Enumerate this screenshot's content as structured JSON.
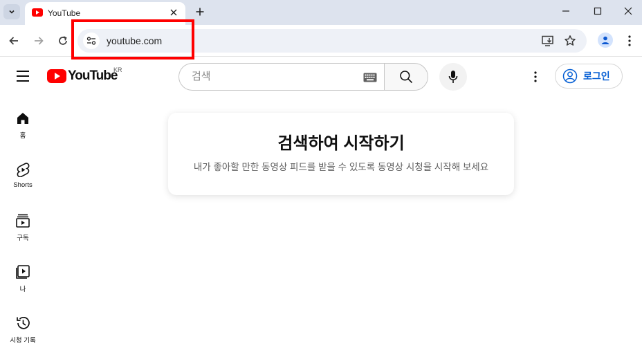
{
  "browser": {
    "tab": {
      "title": "YouTube"
    },
    "address": {
      "url": "youtube.com"
    },
    "colors": {
      "highlight": "#ff0000",
      "tabstrip": "#dde3ee",
      "omnibox": "#eef1f7"
    }
  },
  "masthead": {
    "logo_text": "YouTube",
    "region": "KR",
    "search_placeholder": "검색",
    "signin_label": "로그인"
  },
  "guide": {
    "items": [
      {
        "label": "홈",
        "icon": "home-icon"
      },
      {
        "label": "Shorts",
        "icon": "shorts-icon"
      },
      {
        "label": "구독",
        "icon": "subscriptions-icon"
      },
      {
        "label": "나",
        "icon": "you-icon"
      },
      {
        "label": "시청 기록",
        "icon": "history-icon"
      }
    ]
  },
  "promo": {
    "title": "검색하여 시작하기",
    "body": "내가 좋아할 만한 동영상 피드를 받을 수 있도록 동영상 시청을 시작해 보세요"
  },
  "colors": {
    "brand_red": "#ff0000",
    "link_blue": "#065fd4",
    "secondary_text": "#606060"
  }
}
